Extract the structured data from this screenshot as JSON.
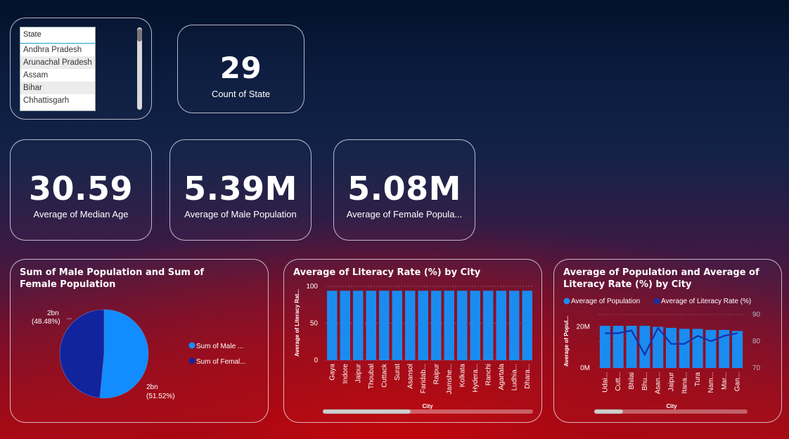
{
  "slicer": {
    "header": "State",
    "items": [
      "Andhra Pradesh",
      "Arunachal Pradesh",
      "Assam",
      "Bihar",
      "Chhattisgarh"
    ]
  },
  "kpis": {
    "count": {
      "value": "29",
      "label": "Count of State"
    },
    "median_age": {
      "value": "30.59",
      "label": "Average of Median Age"
    },
    "male": {
      "value": "5.39M",
      "label": "Average of Male Population"
    },
    "female": {
      "value": "5.08M",
      "label": "Average of Female Popula..."
    }
  },
  "colors": {
    "male": "#118dff",
    "female": "#12239e",
    "bar": "#1a8cf0",
    "line": "#1530a8"
  },
  "chart_data": [
    {
      "type": "pie",
      "title": "Sum of Male Population and Sum of Female Population",
      "slices": [
        {
          "name": "Sum of Male ...",
          "value": 51.52,
          "label": "2bn",
          "pct": "(51.52%)"
        },
        {
          "name": "Sum of Femal...",
          "value": 48.48,
          "label": "2bn",
          "pct": "(48.48%)"
        }
      ],
      "legend": "right"
    },
    {
      "type": "bar",
      "title": "Average of Literacy Rate (%) by City",
      "xlabel": "City",
      "ylabel": "Average of Literacy Rat...",
      "ylim": [
        0,
        100
      ],
      "yticks": [
        "0",
        "50",
        "100"
      ],
      "categories": [
        "Gaya",
        "Indore",
        "Jaipur",
        "Thoubal",
        "Cuttack",
        "Surat",
        "Asansol",
        "Faridab...",
        "Raipur",
        "Jamshe...",
        "Kolkata",
        "Hydera...",
        "Ranchi",
        "Agartala",
        "Ludhia...",
        "Dhara..."
      ],
      "values": [
        94,
        94,
        94,
        94,
        94,
        94,
        94,
        94,
        94,
        94,
        94,
        94,
        94,
        94,
        94,
        94
      ],
      "grid": true
    },
    {
      "type": "bar",
      "title": "Average of Population and Average of Literacy Rate (%) by City",
      "xlabel": "City",
      "ylabel": "Average of Popul...",
      "y2label": "",
      "legend": "top-left",
      "legend_items": [
        "Average of Population",
        "Average of Literacy Rate (%)"
      ],
      "yticks": [
        "0M",
        "20M"
      ],
      "y2ticks": [
        "70",
        "80",
        "90"
      ],
      "ylim": [
        0,
        26
      ],
      "y2lim": [
        70,
        90
      ],
      "categories": [
        "Udai...",
        "Cutt...",
        "Bhilai",
        "Bhu...",
        "Asan...",
        "Jaipur",
        "Itana...",
        "Tura",
        "Nam...",
        "Mar...",
        "Gan..."
      ],
      "series": [
        {
          "name": "Average of Population",
          "kind": "bar",
          "values": [
            20.5,
            20.5,
            20.5,
            20.5,
            20,
            19.5,
            19,
            19,
            18.5,
            18.5,
            18
          ]
        },
        {
          "name": "Average of Literacy Rate (%)",
          "kind": "line",
          "values": [
            83,
            83,
            84,
            75,
            85,
            79,
            79,
            82,
            80,
            82,
            83
          ]
        }
      ]
    }
  ]
}
